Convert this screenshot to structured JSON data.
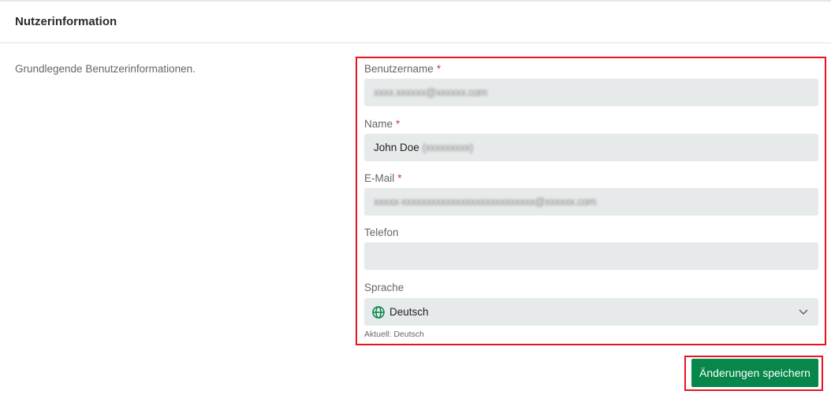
{
  "section": {
    "title": "Nutzerinformation",
    "description": "Grundlegende Benutzerinformationen."
  },
  "form": {
    "username": {
      "label": "Benutzername",
      "required": "*",
      "value": "xxxx.xxxxxx@xxxxxx.com"
    },
    "name": {
      "label": "Name",
      "required": "*",
      "value": "John Doe",
      "value_obscured": "(xxxxxxxxx)"
    },
    "email": {
      "label": "E-Mail",
      "required": "*",
      "value": "xxxxx-xxxxxxxxxxxxxxxxxxxxxxxxxxx@xxxxxx.com"
    },
    "phone": {
      "label": "Telefon",
      "value": ""
    },
    "language": {
      "label": "Sprache",
      "value": "Deutsch",
      "icon": "globe-icon",
      "helper": "Aktuell: Deutsch"
    }
  },
  "actions": {
    "save_label": "Änderungen speichern"
  },
  "colors": {
    "primary": "#07874a",
    "highlight": "#e8141c",
    "required": "#d0343c"
  }
}
